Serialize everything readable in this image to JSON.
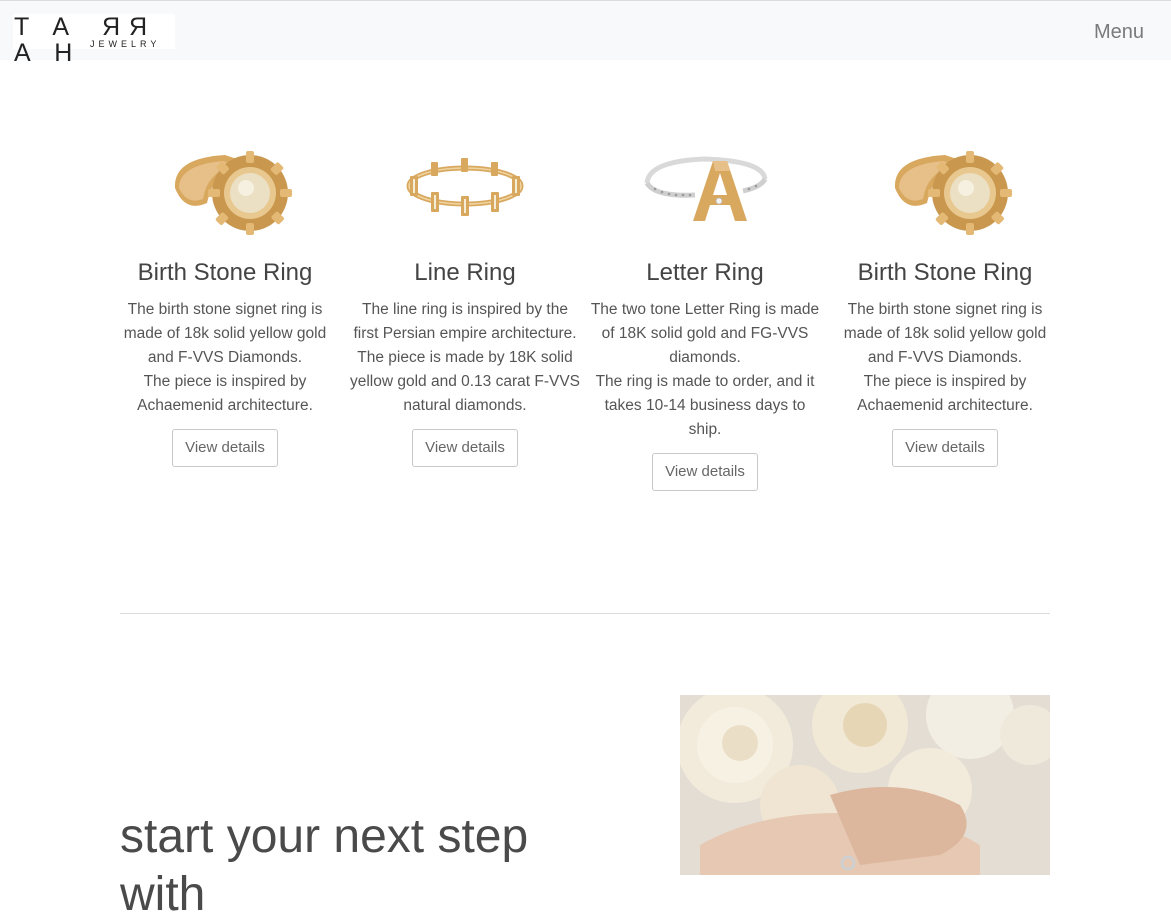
{
  "nav": {
    "logo_main": "TARRAH",
    "logo_sub": "JEWELRY",
    "menu_label": "Menu"
  },
  "products": [
    {
      "name": "Birth Stone Ring",
      "description": [
        "The birth stone signet ring is made of 18k solid yellow gold and F-VVS Diamonds.",
        "The piece is inspired by Achaemenid architecture."
      ],
      "button_label": "View details",
      "image": "birth-stone-ring-image"
    },
    {
      "name": "Line Ring",
      "description": [
        "The line ring is inspired by the first Persian empire architecture.",
        "The piece is made by 18K solid yellow gold and 0.13 carat F-VVS natural diamonds."
      ],
      "button_label": "View details",
      "image": "line-ring-image"
    },
    {
      "name": "Letter Ring",
      "description": [
        "The two tone Letter Ring is made of 18K solid gold and FG-VVS diamonds.",
        "The ring is made to order, and it takes 10-14 business days to ship."
      ],
      "button_label": "View details",
      "image": "letter-ring-image"
    },
    {
      "name": "Birth Stone Ring",
      "description": [
        "The birth stone signet ring is made of 18k solid yellow gold and F-VVS Diamonds.",
        "The piece is inspired by Achaemenid architecture."
      ],
      "button_label": "View details",
      "image": "birth-stone-ring-image"
    }
  ],
  "hero": {
    "heading": "start your next step",
    "heading_second_line_partial": "with"
  },
  "colors": {
    "gold": "#d9a85f",
    "gold_dark": "#b98a42",
    "stone": "#e9dcc0",
    "silver": "#d9d9d9",
    "nav_bg": "#f8f9fa"
  }
}
